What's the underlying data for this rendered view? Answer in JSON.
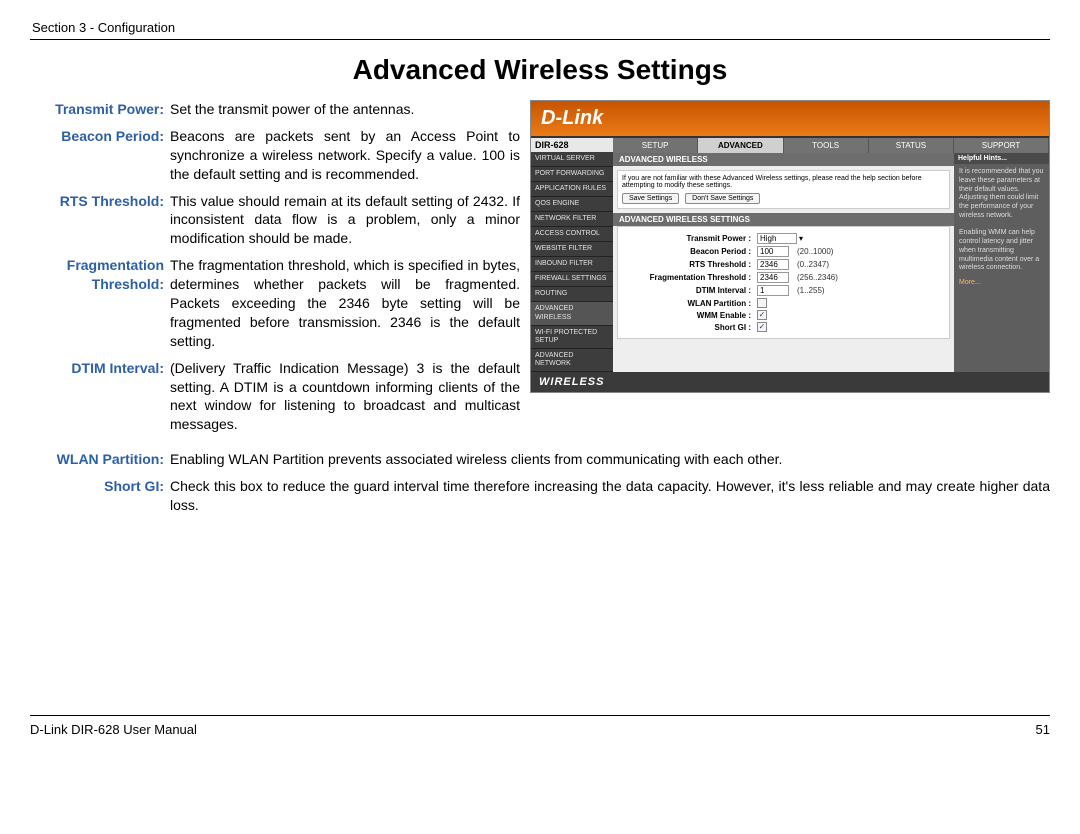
{
  "header": {
    "section": "Section 3 - Configuration"
  },
  "title": "Advanced Wireless Settings",
  "definitions": [
    {
      "label": "Transmit Power:",
      "text": "Set the transmit power of the antennas."
    },
    {
      "label": "Beacon Period:",
      "text": "Beacons are packets sent by an Access Point to synchronize a wireless network. Specify a value. 100 is the default setting and is recommended."
    },
    {
      "label": "RTS Threshold:",
      "text": "This value should remain at its default setting of 2432. If inconsistent data flow is a problem, only a minor modification should be made."
    },
    {
      "label": "Fragmentation Threshold:",
      "text": "The fragmentation threshold, which is specified in bytes, determines whether packets will be fragmented. Packets exceeding the 2346 byte setting will be fragmented before transmission. 2346 is the default setting."
    },
    {
      "label": "DTIM Interval:",
      "text": "(Delivery Traffic Indication Message) 3 is the default setting. A DTIM is a countdown informing clients of the next window for listening to broadcast and multicast messages."
    },
    {
      "label": "WLAN Partition:",
      "text": "Enabling WLAN Partition prevents associated wireless clients from communicating with each other."
    },
    {
      "label": "Short GI:",
      "text": "Check this box to reduce the guard interval time therefore increasing the data capacity.  However, it's less reliable and may create higher data loss."
    }
  ],
  "screenshot": {
    "brand": "D-Link",
    "model": "DIR-628",
    "tabs": [
      "SETUP",
      "ADVANCED",
      "TOOLS",
      "STATUS",
      "SUPPORT"
    ],
    "active_tab": "ADVANCED",
    "sidebar": [
      "VIRTUAL SERVER",
      "PORT FORWARDING",
      "APPLICATION RULES",
      "QOS ENGINE",
      "NETWORK FILTER",
      "ACCESS CONTROL",
      "WEBSITE FILTER",
      "INBOUND FILTER",
      "FIREWALL SETTINGS",
      "ROUTING",
      "ADVANCED WIRELESS",
      "WI-FI PROTECTED SETUP",
      "ADVANCED NETWORK"
    ],
    "bar1": "ADVANCED WIRELESS",
    "note": "If you are not familiar with these Advanced Wireless settings, please read the help section before attempting to modify these settings.",
    "btn_save": "Save Settings",
    "btn_dont": "Don't Save Settings",
    "bar2": "ADVANCED WIRELESS SETTINGS",
    "form": {
      "transmit_label": "Transmit Power :",
      "transmit_value": "High",
      "beacon_label": "Beacon Period :",
      "beacon_value": "100",
      "beacon_range": "(20..1000)",
      "rts_label": "RTS Threshold :",
      "rts_value": "2346",
      "rts_range": "(0..2347)",
      "frag_label": "Fragmentation Threshold :",
      "frag_value": "2346",
      "frag_range": "(256..2346)",
      "dtim_label": "DTIM Interval :",
      "dtim_value": "1",
      "dtim_range": "(1..255)",
      "wlan_label": "WLAN Partition :",
      "wmm_label": "WMM Enable :",
      "short_label": "Short GI :"
    },
    "hints_hdr": "Helpful Hints...",
    "hints_body1": "It is recommended that you leave these parameters at their default values. Adjusting them could limit the performance of your wireless network.",
    "hints_body2": "Enabling WMM can help control latency and jitter when transmitting multimedia content over a wireless connection.",
    "hints_more": "More...",
    "footer": "WIRELESS"
  },
  "footer": {
    "left": "D-Link DIR-628 User Manual",
    "right": "51"
  }
}
